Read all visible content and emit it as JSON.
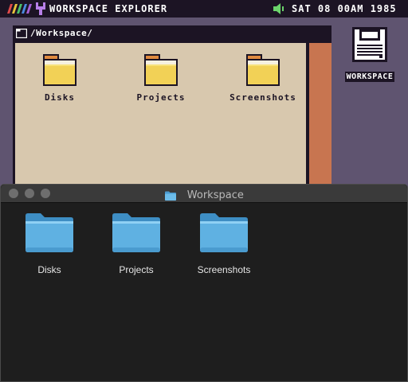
{
  "retro": {
    "menubar": {
      "app_title": "WORKSPACE EXPLORER",
      "clock": "SAT 08 00AM 1985"
    },
    "window": {
      "path": "/Workspace/"
    },
    "folders": [
      {
        "label": "Disks"
      },
      {
        "label": "Projects"
      },
      {
        "label": "Screenshots"
      }
    ],
    "drive": {
      "label": "WORKSPACE"
    }
  },
  "mac": {
    "title": "Workspace",
    "folders": [
      {
        "label": "Disks"
      },
      {
        "label": "Projects"
      },
      {
        "label": "Screenshots"
      }
    ]
  },
  "colors": {
    "retro_bg": "#5f5470",
    "retro_dark": "#1c1424",
    "retro_content": "#d8c8ae",
    "retro_scroll": "#c87550",
    "folder_yellow": "#f2d156",
    "mac_bg": "#1e1e1e",
    "mac_folder": "#5fb1e2"
  }
}
